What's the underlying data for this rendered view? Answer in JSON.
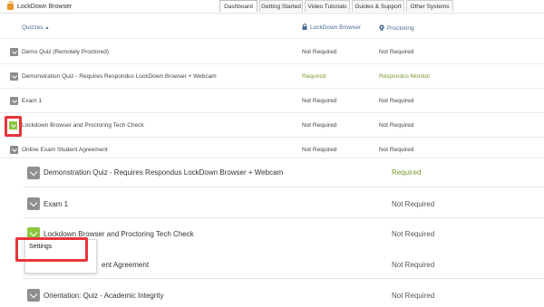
{
  "app": {
    "title": "LockDown Browser"
  },
  "tabs": [
    {
      "label": "Dashboard",
      "active": true
    },
    {
      "label": "Getting Started"
    },
    {
      "label": "Video Tutorials"
    },
    {
      "label": "Guides & Support"
    },
    {
      "label": "Other Systems"
    }
  ],
  "table_header": {
    "quizzes": "Quizzes",
    "sort_indicator": "▲",
    "lockdown_browser": "LockDown Browser",
    "proctoring": "Proctoring"
  },
  "quizzes": [
    {
      "name": "Demo Quiz (Remotely Proctored)",
      "lockdown": "Not Required",
      "proctoring": "Not Required"
    },
    {
      "name": "Demonstration Quiz - Requires Respondus LockDown Browser + Webcam",
      "lockdown": "Required",
      "proctoring": "Respondus Monitor"
    },
    {
      "name": "Exam 1",
      "lockdown": "Not Required",
      "proctoring": "Not Required"
    },
    {
      "name": "Lockdown Browser and Proctoring Tech Check",
      "lockdown": "Not Required",
      "proctoring": "Not Required"
    },
    {
      "name": "Online Exam Student Agreement",
      "lockdown": "Not Required",
      "proctoring": "Not Required"
    }
  ],
  "zoom_rows": [
    {
      "name": "Demonstration Quiz - Requires Respondus LockDown Browser + Webcam",
      "status": "Required"
    },
    {
      "name": "Exam 1",
      "status": "Not Required"
    },
    {
      "name": "Lockdown Browser and Proctoring Tech Check",
      "status": "Not Required"
    },
    {
      "name": "ent Agreement",
      "status": "Not Required"
    },
    {
      "name": "Orientation: Quiz - Academic Integrity",
      "status": "Not Required"
    }
  ],
  "menu": {
    "settings": "Settings"
  },
  "colors": {
    "required": "#7a9a2e",
    "highlight": "#e8343a",
    "accent": "#8cc63f",
    "header_text": "#4a6b91"
  }
}
